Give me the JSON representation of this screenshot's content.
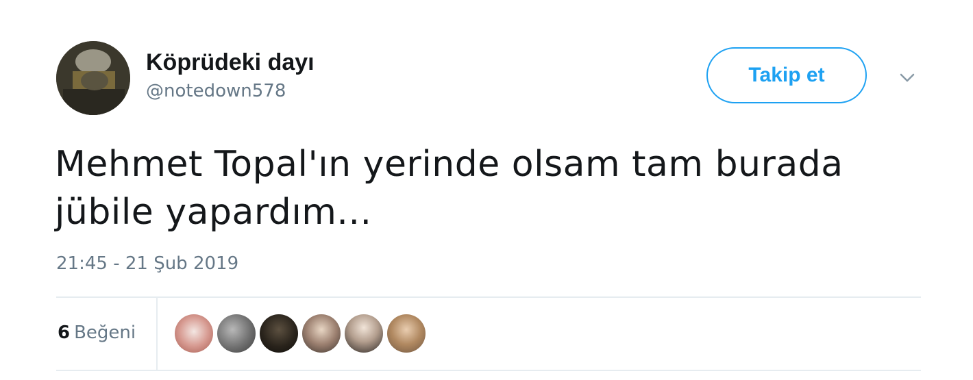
{
  "author": {
    "display_name": "Köprüdeki dayı",
    "handle": "@notedown578",
    "avatar_icon": "user-avatar"
  },
  "follow_button": {
    "label": "Takip et",
    "color": "#1da1f2"
  },
  "menu": {
    "icon": "chevron-down-icon"
  },
  "tweet": {
    "text_line1": "Mehmet Topal'ın yerinde olsam tam burada",
    "text_line2": "jübile yapardım...",
    "timestamp": "21:45 - 21 Şub 2019"
  },
  "stats": {
    "likes_count": "6",
    "likes_label": "Beğeni",
    "liker_avatars": [
      "liker-avatar-1",
      "liker-avatar-2",
      "liker-avatar-3",
      "liker-avatar-4",
      "liker-avatar-5",
      "liker-avatar-6"
    ]
  },
  "colors": {
    "text_primary": "#14171a",
    "text_secondary": "#657786",
    "divider": "#e6ecf0",
    "accent": "#1da1f2"
  }
}
